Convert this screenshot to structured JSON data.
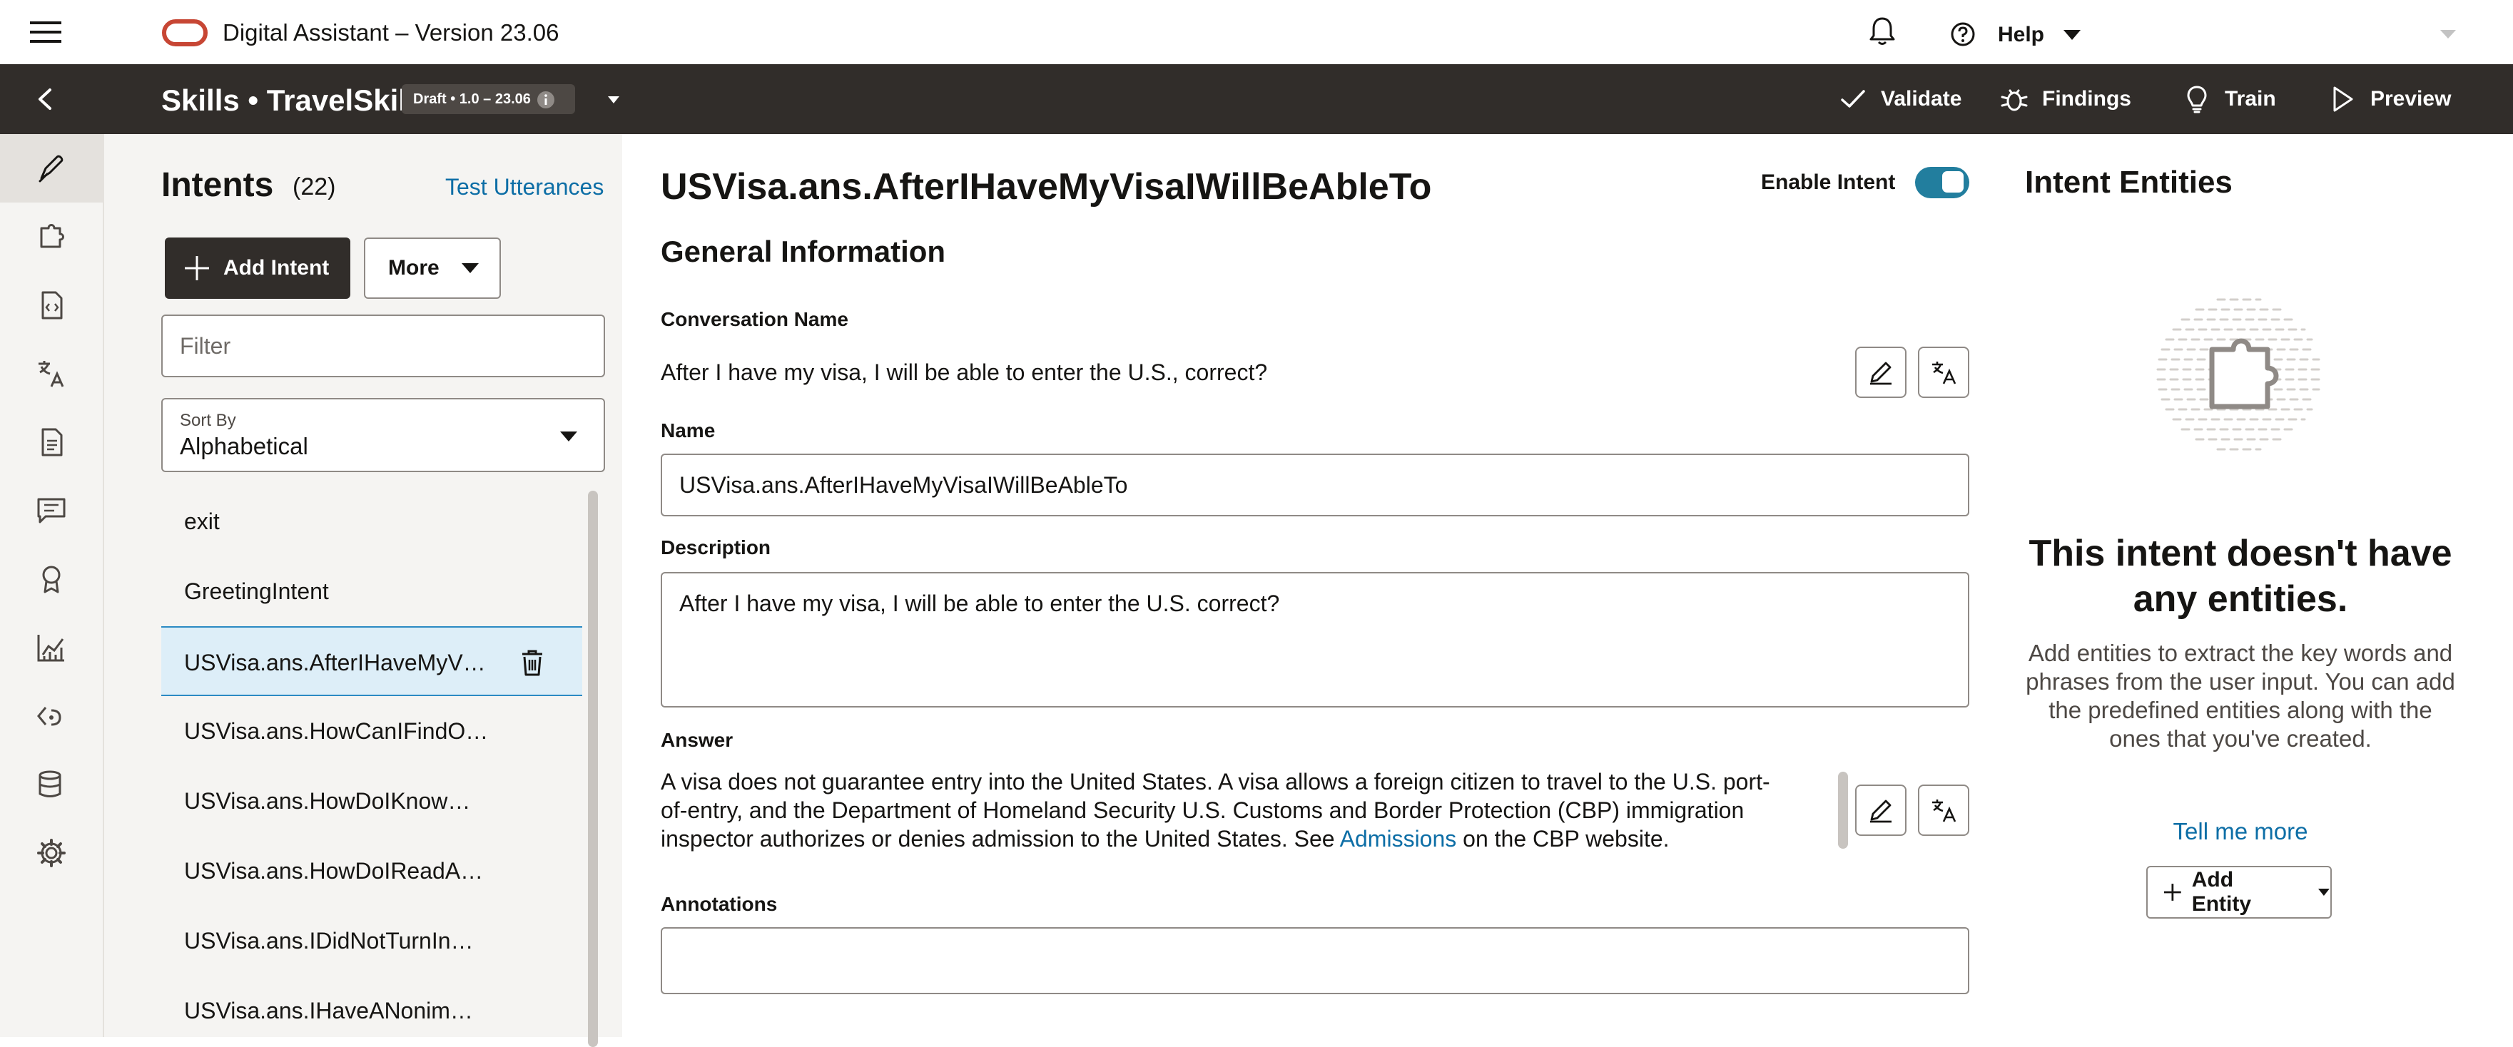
{
  "app": {
    "title": "Digital Assistant – Version 23.06",
    "help_label": "Help"
  },
  "nav": {
    "breadcrumb": "Skills • TravelSkill",
    "draft_badge": "Draft • 1.0 – 23.06",
    "validate": "Validate",
    "findings": "Findings",
    "train": "Train",
    "preview": "Preview"
  },
  "rail": {
    "items": [
      "edit-icon",
      "puzzle-icon",
      "code-doc-icon",
      "translate-icon",
      "document-icon",
      "chat-icon",
      "badge-icon",
      "chart-icon",
      "route-icon",
      "database-icon",
      "gear-icon"
    ],
    "active_index": 0
  },
  "intents": {
    "title": "Intents",
    "count": "(22)",
    "test_utterances": "Test Utterances",
    "add_intent": "Add Intent",
    "more": "More",
    "filter_placeholder": "Filter",
    "sort_label": "Sort By",
    "sort_value": "Alphabetical",
    "items": [
      "exit",
      "GreetingIntent",
      "USVisa.ans.AfterIHaveMyV…",
      "USVisa.ans.HowCanIFindO…",
      "USVisa.ans.HowDoIKnow…",
      "USVisa.ans.HowDoIReadA…",
      "USVisa.ans.IDidNotTurnIn…",
      "USVisa.ans.IHaveANonim…"
    ],
    "selected_index": 2
  },
  "main": {
    "title": "USVisa.ans.AfterIHaveMyVisaIWillBeAbleTo",
    "enable_label": "Enable Intent",
    "enable_on": true,
    "section_title": "General Information",
    "conversation_name_label": "Conversation Name",
    "conversation_name": "After I have my visa, I will be able to enter the U.S., correct?",
    "name_label": "Name",
    "name_value": "USVisa.ans.AfterIHaveMyVisaIWillBeAbleTo",
    "description_label": "Description",
    "description_value": "After I have my visa, I will be able to enter the U.S. correct?",
    "answer_label": "Answer",
    "answer_text_before": "A visa does not guarantee entry into the United States. A visa allows a foreign citizen to travel to the U.S. port-of-entry, and the Department of Homeland Security U.S. Customs and Border Protection (CBP) immigration inspector authorizes or denies admission to the United States. See ",
    "answer_link": "Admissions",
    "answer_text_after": " on the CBP website.",
    "annotations_label": "Annotations",
    "annotations_value": ""
  },
  "entities": {
    "title": "Intent Entities",
    "empty_heading": "This intent doesn't have any entities.",
    "empty_body": "Add entities to extract the key words and phrases from the user input. You can add the predefined entities along with the ones that you've created.",
    "tell_me_more": "Tell me more",
    "add_entity": "Add Entity"
  },
  "colors": {
    "nav_bg": "#312d2a",
    "accent_blue": "#0d6ea6",
    "toggle_on": "#227e9e",
    "selected_row": "#ddeef8",
    "brand_red": "#c74634"
  }
}
